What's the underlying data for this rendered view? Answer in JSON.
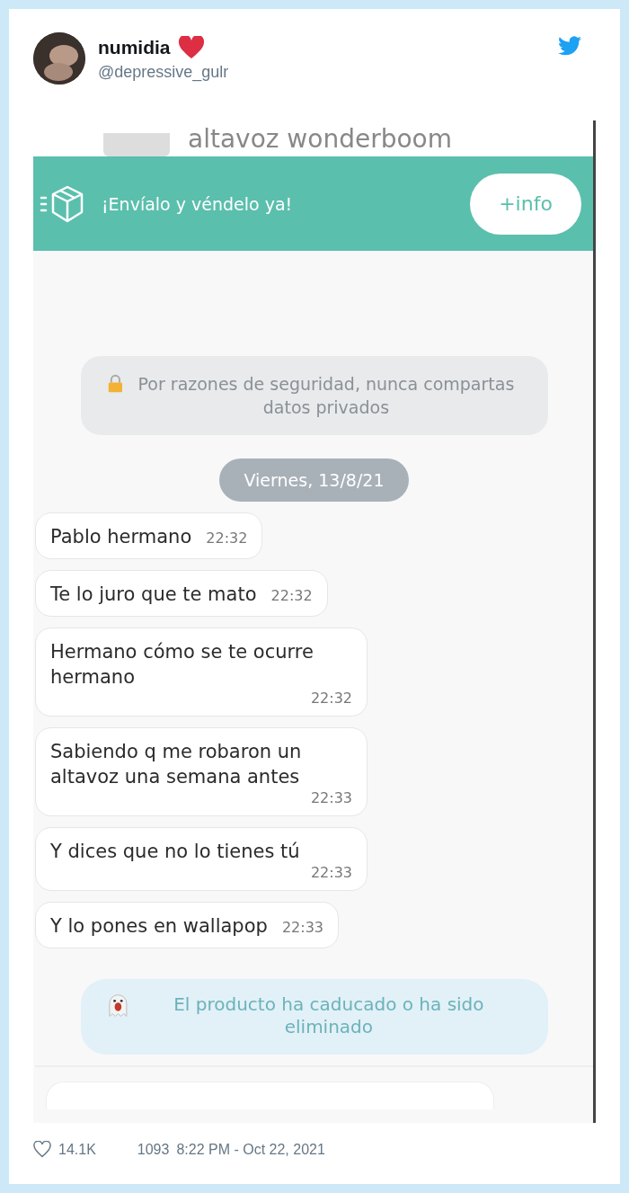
{
  "tweet": {
    "name": "numidia",
    "handle": "@depressive_gulr",
    "likes": "14.1K",
    "replies": "1093",
    "timestamp": "8:22 PM - Oct 22, 2021"
  },
  "chat": {
    "product_title": "altavoz wonderboom",
    "banner": {
      "text": "¡Envíalo y véndelo ya!",
      "button": "+info"
    },
    "security_notice": "Por razones de seguridad, nunca compartas datos privados",
    "date": "Viernes, 13/8/21",
    "messages": [
      {
        "text": "Pablo hermano",
        "time": "22:32"
      },
      {
        "text": "Te lo juro que te mato",
        "time": "22:32"
      },
      {
        "text": "Hermano cómo se te ocurre hermano",
        "time": "22:32"
      },
      {
        "text": "Sabiendo q me robaron un altavoz una semana antes",
        "time": "22:33"
      },
      {
        "text": "Y dices que no lo tienes tú",
        "time": "22:33"
      },
      {
        "text": "Y lo pones en wallapop",
        "time": "22:33"
      }
    ],
    "expired_notice": "El producto ha caducado o ha sido eliminado"
  }
}
